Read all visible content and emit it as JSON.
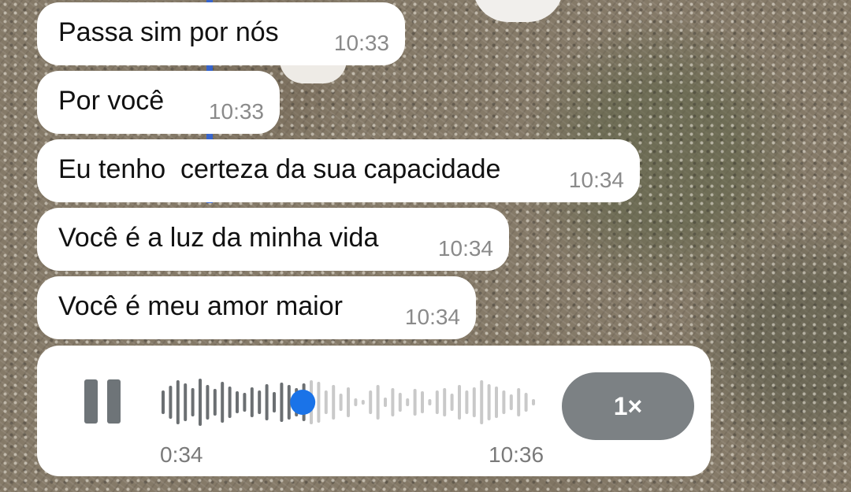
{
  "messages": [
    {
      "text": "Passa sim por nós",
      "time": "10:33"
    },
    {
      "text": "Por você",
      "time": "10:33"
    },
    {
      "text": "Eu tenho  certeza da sua capacidade",
      "time": "10:34"
    },
    {
      "text": "Você é a luz da minha vida",
      "time": "10:34"
    },
    {
      "text": "Você é meu amor maior",
      "time": "10:34"
    }
  ],
  "voice_message": {
    "state_icon": "pause-icon",
    "progress": 0.38,
    "elapsed": "0:34",
    "time": "10:36",
    "speed_label": "1×",
    "colors": {
      "played": "#6b6f72",
      "unplayed": "#c9c9c9",
      "thumb": "#1a73e8",
      "speed_bg": "#7c8184"
    }
  }
}
